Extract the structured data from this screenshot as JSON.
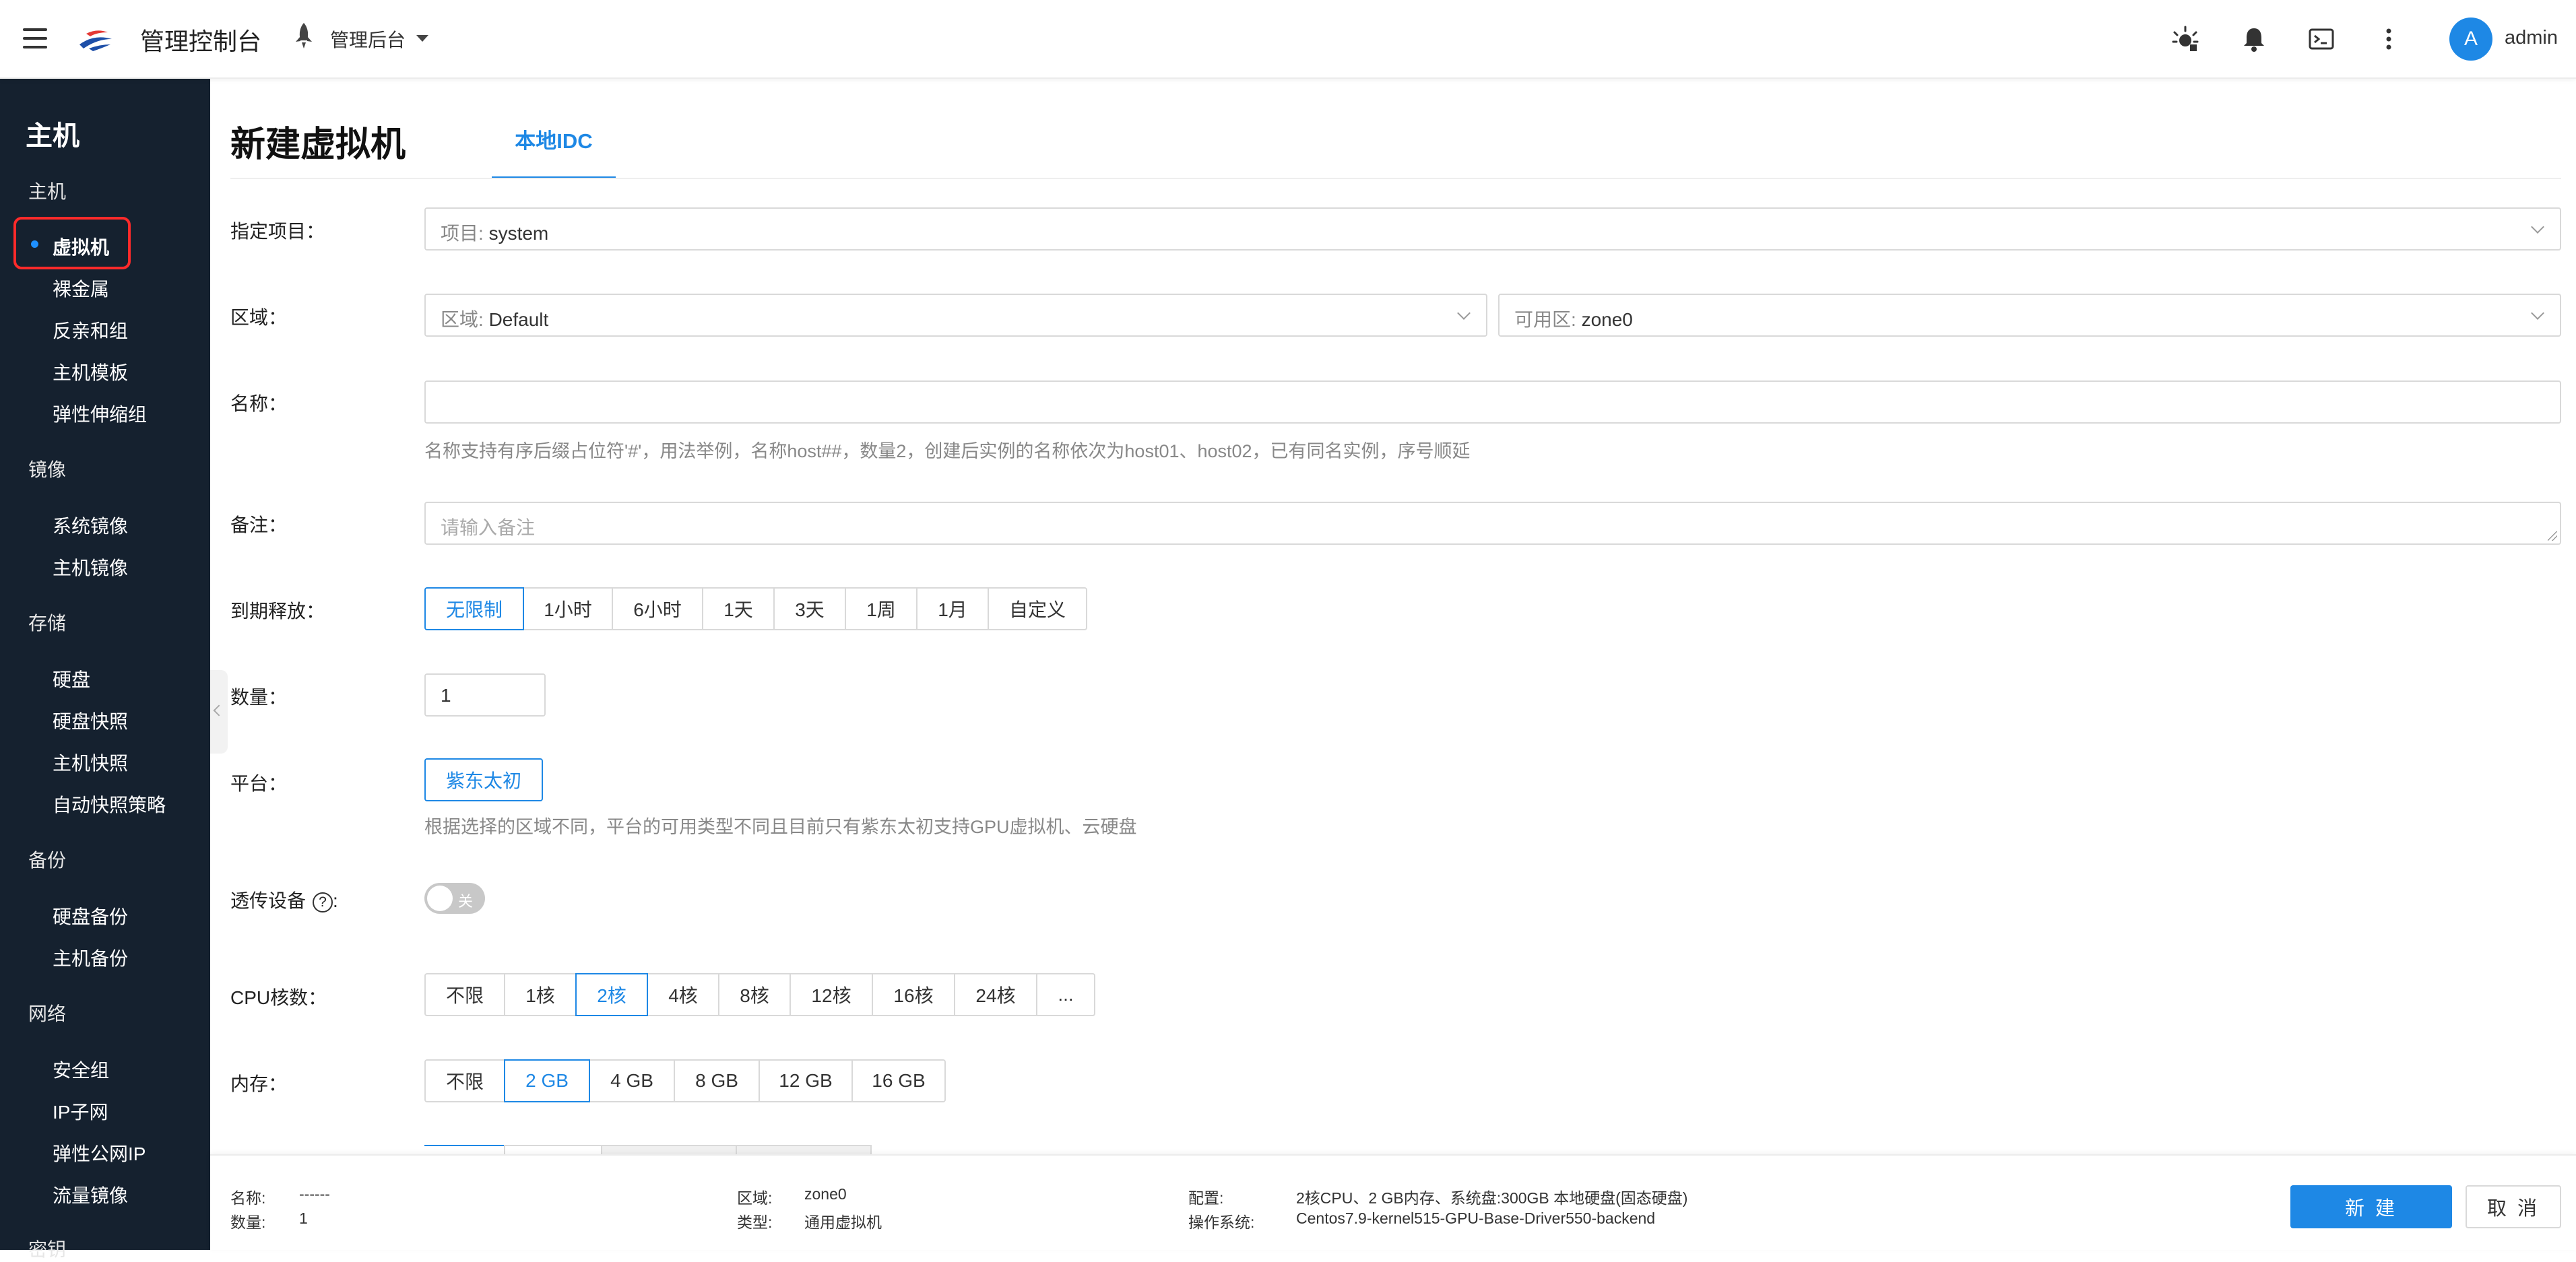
{
  "header": {
    "app_title": "管理控制台",
    "project_switch": "管理后台",
    "username": "admin",
    "avatar_letter": "A",
    "icons": [
      "hamburger-icon",
      "logo",
      "rocket-icon",
      "theme-icon",
      "bell-icon",
      "terminal-icon",
      "more-vertical-icon"
    ]
  },
  "sidebar": {
    "title": "主机",
    "groups": [
      {
        "label": "主机",
        "items": [
          "虚拟机",
          "裸金属",
          "反亲和组",
          "主机模板",
          "弹性伸缩组"
        ]
      },
      {
        "label": "镜像",
        "items": [
          "系统镜像",
          "主机镜像"
        ]
      },
      {
        "label": "存储",
        "items": [
          "硬盘",
          "硬盘快照",
          "主机快照",
          "自动快照策略"
        ]
      },
      {
        "label": "备份",
        "items": [
          "硬盘备份",
          "主机备份"
        ]
      },
      {
        "label": "网络",
        "items": [
          "安全组",
          "IP子网",
          "弹性公网IP",
          "流量镜像"
        ]
      },
      {
        "label": "密钥",
        "items": []
      }
    ],
    "active_item": "虚拟机"
  },
  "page": {
    "title": "新建虚拟机",
    "tab": "本地IDC"
  },
  "form": {
    "project": {
      "label": "指定项目：",
      "prefix": "项目: ",
      "value": "system"
    },
    "region": {
      "label": "区域：",
      "prefix": "区域: ",
      "value": "Default",
      "zone_prefix": "可用区: ",
      "zone_value": "zone0"
    },
    "name": {
      "label": "名称：",
      "value": "",
      "hint": "名称支持有序后缀占位符'#'，用法举例，名称host##，数量2，创建后实例的名称依次为host01、host02，已有同名实例，序号顺延"
    },
    "remark": {
      "label": "备注：",
      "placeholder": "请输入备注"
    },
    "expire": {
      "label": "到期释放：",
      "options": [
        "无限制",
        "1小时",
        "6小时",
        "1天",
        "3天",
        "1周",
        "1月",
        "自定义"
      ],
      "selected": "无限制"
    },
    "quantity": {
      "label": "数量：",
      "value": "1"
    },
    "platform": {
      "label": "平台：",
      "value": "紫东太初",
      "hint": "根据选择的区域不同，平台的可用类型不同且目前只有紫东太初支持GPU虚拟机、云硬盘"
    },
    "passthrough": {
      "label": "透传设备",
      "help": "?",
      "colon": ":",
      "toggle_text": "关"
    },
    "cpu": {
      "label": "CPU核数：",
      "options": [
        "不限",
        "1核",
        "2核",
        "4核",
        "8核",
        "12核",
        "16核",
        "24核",
        "..."
      ],
      "selected": "2核"
    },
    "memory": {
      "label": "内存：",
      "options": [
        "不限",
        "2 GB",
        "4 GB",
        "8 GB",
        "12 GB",
        "16 GB"
      ],
      "selected": "2 GB"
    }
  },
  "footer": {
    "name_label": "名称:",
    "name_value": "------",
    "qty_label": "数量:",
    "qty_value": "1",
    "region_label": "区域:",
    "region_value": "zone0",
    "type_label": "类型:",
    "type_value": "通用虚拟机",
    "config_label": "配置:",
    "config_value": "2核CPU、2 GB内存、系统盘:300GB 本地硬盘(固态硬盘)",
    "os_label": "操作系统:",
    "os_value": "Centos7.9-kernel515-GPU-Base-Driver550-backend",
    "create_label": "新 建",
    "cancel_label": "取 消"
  },
  "colors": {
    "accent": "#1e88e5",
    "sidebar_bg": "#15212f",
    "active_outline": "#ff2a2a"
  }
}
